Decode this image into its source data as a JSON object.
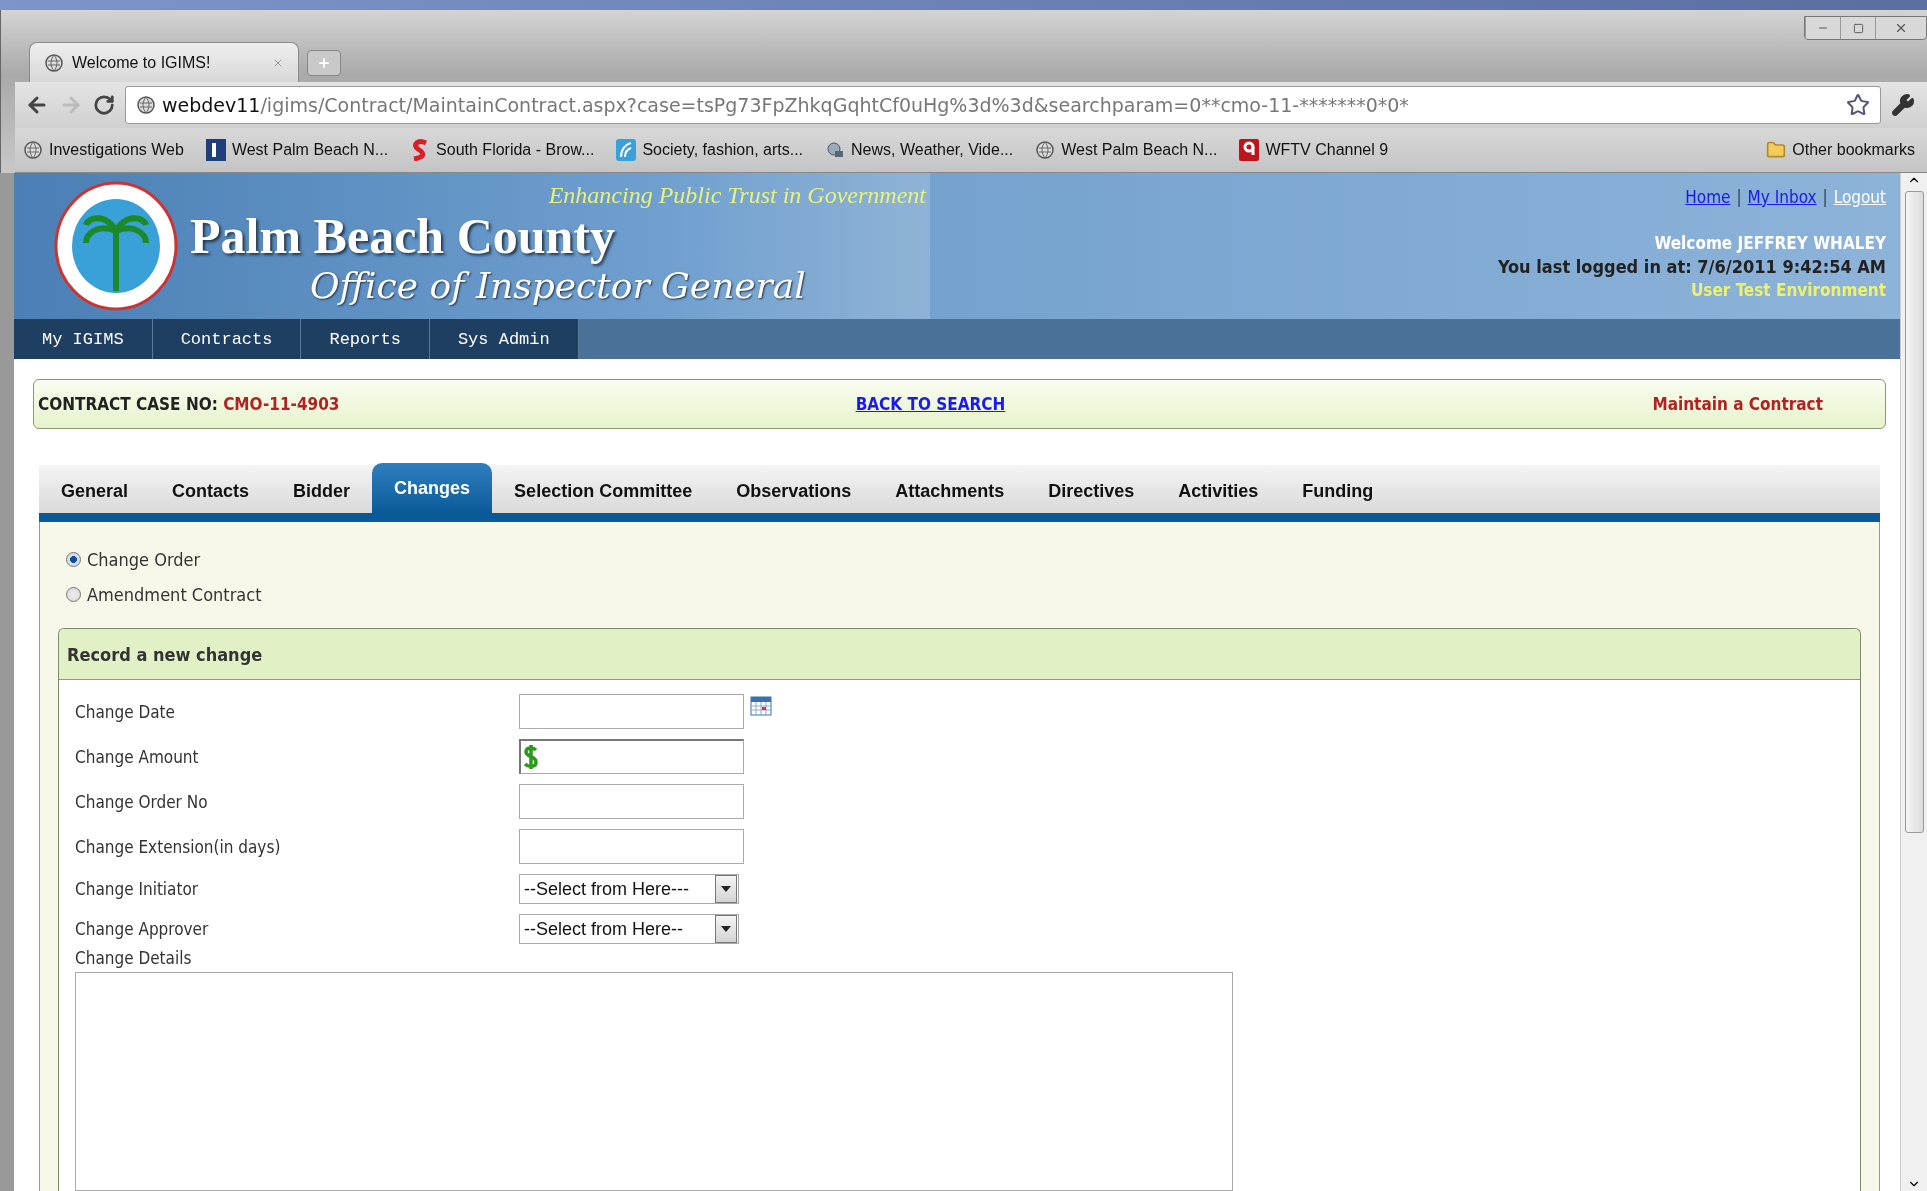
{
  "browser": {
    "tab_title": "Welcome to IGIMS!",
    "url_host": "webdev11",
    "url_path": "/igims/Contract/MaintainContract.aspx?case=tsPg73FpZhkqGqhtCf0uHg%3d%3d&searchparam=0**cmo-11-*******0*0*",
    "bookmarks": [
      {
        "kind": "globe",
        "label": "Investigations Web"
      },
      {
        "kind": "square",
        "label": "West Palm Beach N..."
      },
      {
        "kind": "swoosh",
        "label": "South Florida - Brow..."
      },
      {
        "kind": "leaf",
        "label": "Society, fashion, arts..."
      },
      {
        "kind": "news",
        "label": "News, Weather, Vide..."
      },
      {
        "kind": "globe",
        "label": "West Palm Beach N..."
      },
      {
        "kind": "channel",
        "label": "WFTV Channel 9"
      }
    ],
    "other_bookmarks": "Other bookmarks"
  },
  "header": {
    "title": "Palm Beach County",
    "subtitle": "Office of Inspector General",
    "tagline": "Enhancing Public Trust in Government",
    "link_separator": "|",
    "links": [
      {
        "label": "Home",
        "visited": false
      },
      {
        "label": "My Inbox",
        "visited": false
      },
      {
        "label": "Logout",
        "visited": true
      }
    ],
    "welcome": "Welcome JEFFREY WHALEY",
    "last_login": "You last logged in at: 7/6/2011 9:42:54 AM",
    "environment": "User Test Environment"
  },
  "nav": [
    "My IGIMS",
    "Contracts",
    "Reports",
    "Sys Admin"
  ],
  "case_bar": {
    "label": "CONTRACT CASE NO:",
    "number": "CMO-11-4903",
    "back_link": "BACK TO SEARCH",
    "page_title": "Maintain a Contract"
  },
  "tabs": [
    {
      "label": "General",
      "selected": false
    },
    {
      "label": "Contacts",
      "selected": false
    },
    {
      "label": "Bidder",
      "selected": false
    },
    {
      "label": "Changes",
      "selected": true
    },
    {
      "label": "Selection Committee",
      "selected": false
    },
    {
      "label": "Observations",
      "selected": false
    },
    {
      "label": "Attachments",
      "selected": false
    },
    {
      "label": "Directives",
      "selected": false
    },
    {
      "label": "Activities",
      "selected": false
    },
    {
      "label": "Funding",
      "selected": false
    }
  ],
  "change_type": [
    {
      "label": "Change Order",
      "selected": true
    },
    {
      "label": "Amendment Contract",
      "selected": false
    }
  ],
  "section": {
    "title": "Record a new change",
    "fields": [
      {
        "kind": "date",
        "label": "Change Date"
      },
      {
        "kind": "currency",
        "label": "Change Amount"
      },
      {
        "kind": "text",
        "label": "Change Order No"
      },
      {
        "kind": "text",
        "label": "Change Extension(in days)"
      },
      {
        "kind": "select",
        "label": "Change Initiator",
        "value": "--Select from Here---"
      },
      {
        "kind": "select",
        "label": "Change Approver",
        "value": "--Select from Here--"
      }
    ],
    "details_label": "Change Details"
  }
}
